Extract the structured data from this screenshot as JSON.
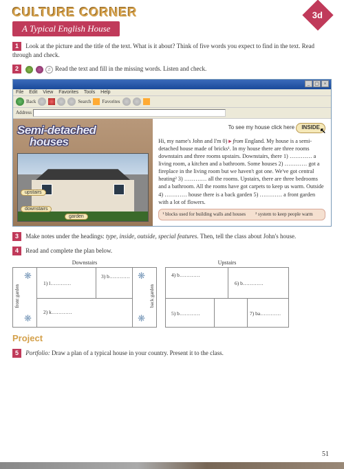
{
  "badge": "3d",
  "header": {
    "culture": "CULTURE CORNER",
    "subtitle": "A Typical English House"
  },
  "tasks": {
    "t1_num": "1",
    "t1": "Look at the picture and the title of the text. What is it about? Think of five words you expect to find in the text. Read through and check.",
    "t2_num": "2",
    "t2": "Read the text and fill in the missing words. Listen and check.",
    "t3_num": "3",
    "t3_a": "Make notes under the headings: ",
    "t3_b": "type, inside, outside, special features.",
    "t3_c": " Then, tell the class about John's house.",
    "t4_num": "4",
    "t4": "Read and complete the plan below.",
    "t5_num": "5",
    "t5_a": "Portfolio:",
    "t5_b": " Draw a plan of a typical house in your country. Present it to the class."
  },
  "browser": {
    "menu": {
      "file": "File",
      "edit": "Edit",
      "view": "View",
      "fav": "Favorites",
      "tools": "Tools",
      "help": "Help"
    },
    "toolbar": {
      "back": "Back",
      "search": "Search",
      "favs": "Favorites"
    },
    "addr_label": "Address"
  },
  "article": {
    "title1": "Semi-detached",
    "title2": "houses",
    "labels": {
      "upstairs": "upstairs",
      "downstairs": "downstairs",
      "garden": "garden"
    },
    "inside_text": "To see my house click here",
    "inside_btn": "INSIDE",
    "body_1": "Hi, my name's John and I'm 0) ",
    "body_ex": "from",
    "body_2": " England. My house is a semi-detached house made of bricks¹. In my house there are three rooms downstairs and three rooms upstairs. Downstairs, there 1) ………… a living room, a kitchen and a bathroom. Some houses 2) ………… got a fireplace in the living room but we haven't got one. We've got central heating² 3) ………… all the rooms. Upstairs, there are three bedrooms and a bathroom. All the rooms have got carpets to keep us warm. Outside 4) ………… house there is a back garden 5) ………… a front garden with a lot of flowers.",
    "fn1": "¹ blocks used for building walls and houses",
    "fn2": "² system to keep people warm"
  },
  "plans": {
    "down_title": "Downstairs",
    "up_title": "Upstairs",
    "front": "front garden",
    "back": "back garden",
    "d1": "1) l…………",
    "d2": "2) k…………",
    "d3": "3) b…………",
    "u4": "4) b…………",
    "u5": "5) b…………",
    "u6": "6) b…………",
    "u7": "7) ba…………"
  },
  "project": "Project",
  "page_num": "51"
}
